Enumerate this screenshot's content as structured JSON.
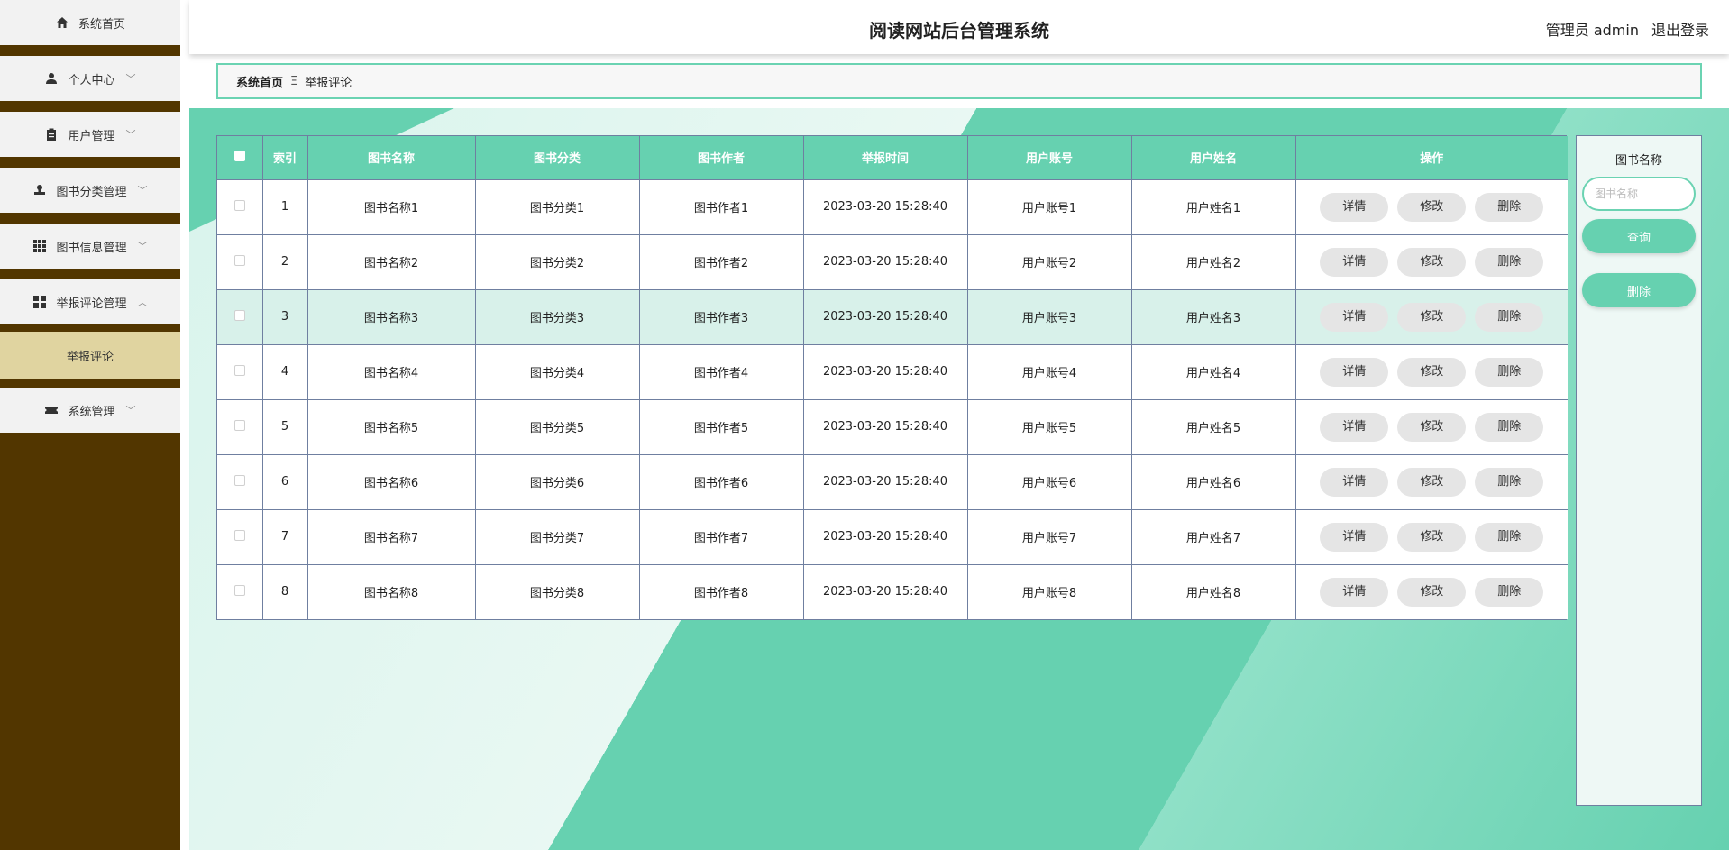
{
  "sidebar": {
    "items": [
      {
        "label": "系统首页",
        "icon": "home-icon",
        "has_arrow": false
      },
      {
        "label": "个人中心",
        "icon": "user-icon",
        "has_arrow": true
      },
      {
        "label": "用户管理",
        "icon": "clipboard-icon",
        "has_arrow": true
      },
      {
        "label": "图书分类管理",
        "icon": "stamp-icon",
        "has_arrow": true
      },
      {
        "label": "图书信息管理",
        "icon": "grid-icon",
        "has_arrow": true
      },
      {
        "label": "举报评论管理",
        "icon": "dashboard-icon",
        "has_arrow": true,
        "expanded": true
      },
      {
        "label": "系统管理",
        "icon": "ticket-icon",
        "has_arrow": true
      }
    ],
    "submenu": {
      "label": "举报评论"
    }
  },
  "header": {
    "title": "阅读网站后台管理系统",
    "user_label": "管理员 admin",
    "logout_label": "退出登录"
  },
  "breadcrumb": {
    "home": "系统首页",
    "separator": "Ξ",
    "current": "举报评论"
  },
  "table": {
    "columns": [
      "索引",
      "图书名称",
      "图书分类",
      "图书作者",
      "举报时间",
      "用户账号",
      "用户姓名",
      "操作"
    ],
    "actions": {
      "detail": "详情",
      "edit": "修改",
      "delete": "删除"
    },
    "rows": [
      {
        "index": "1",
        "book_name": "图书名称1",
        "category": "图书分类1",
        "author": "图书作者1",
        "time": "2023-03-20 15:28:40",
        "account": "用户账号1",
        "username": "用户姓名1"
      },
      {
        "index": "2",
        "book_name": "图书名称2",
        "category": "图书分类2",
        "author": "图书作者2",
        "time": "2023-03-20 15:28:40",
        "account": "用户账号2",
        "username": "用户姓名2"
      },
      {
        "index": "3",
        "book_name": "图书名称3",
        "category": "图书分类3",
        "author": "图书作者3",
        "time": "2023-03-20 15:28:40",
        "account": "用户账号3",
        "username": "用户姓名3"
      },
      {
        "index": "4",
        "book_name": "图书名称4",
        "category": "图书分类4",
        "author": "图书作者4",
        "time": "2023-03-20 15:28:40",
        "account": "用户账号4",
        "username": "用户姓名4"
      },
      {
        "index": "5",
        "book_name": "图书名称5",
        "category": "图书分类5",
        "author": "图书作者5",
        "time": "2023-03-20 15:28:40",
        "account": "用户账号5",
        "username": "用户姓名5"
      },
      {
        "index": "6",
        "book_name": "图书名称6",
        "category": "图书分类6",
        "author": "图书作者6",
        "time": "2023-03-20 15:28:40",
        "account": "用户账号6",
        "username": "用户姓名6"
      },
      {
        "index": "7",
        "book_name": "图书名称7",
        "category": "图书分类7",
        "author": "图书作者7",
        "time": "2023-03-20 15:28:40",
        "account": "用户账号7",
        "username": "用户姓名7"
      },
      {
        "index": "8",
        "book_name": "图书名称8",
        "category": "图书分类8",
        "author": "图书作者8",
        "time": "2023-03-20 15:28:40",
        "account": "用户账号8",
        "username": "用户姓名8"
      }
    ],
    "highlighted_row": 3
  },
  "search": {
    "label": "图书名称",
    "placeholder": "图书名称",
    "query_button": "查询",
    "delete_button": "删除"
  },
  "colors": {
    "accent": "#66d1b0",
    "sidebar_bg": "#523600",
    "submenu_bg": "#e0d4a0"
  }
}
